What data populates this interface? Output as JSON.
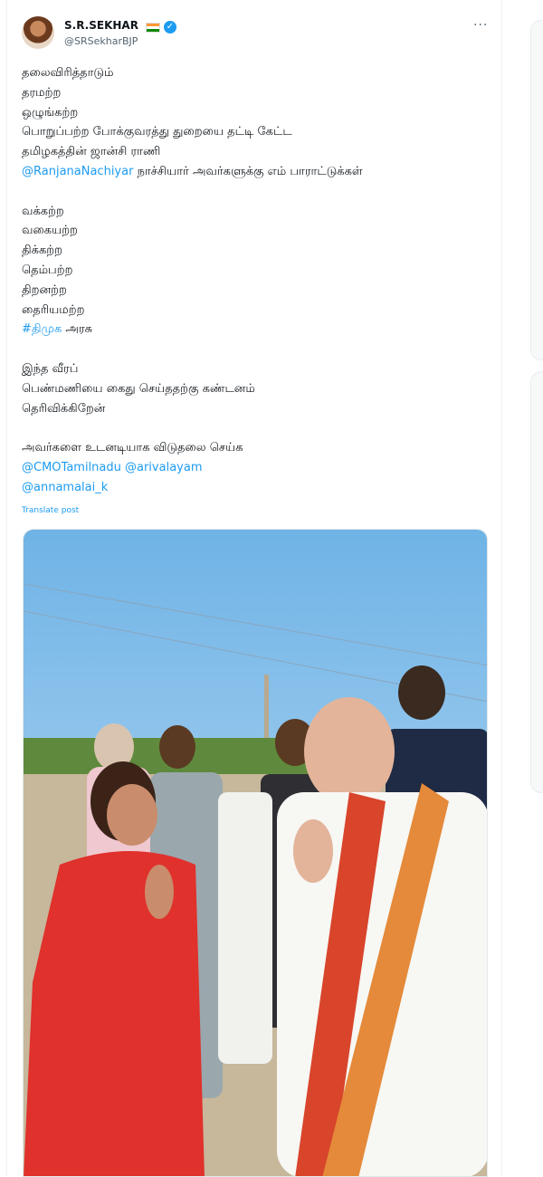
{
  "post": {
    "author_name": "S.R.SEKHAR",
    "author_handle": "@SRSekharBJP",
    "more_label": "···",
    "paragraphs": [
      [
        {
          "text": "தலைவிரித்தாடும்",
          "link": false
        },
        {
          "text": "தரமற்ற",
          "link": false
        },
        {
          "text": "ஒழுங்கற்ற",
          "link": false
        },
        {
          "text": "பொறுப்பற்ற போக்குவரத்து துறையை தட்டி கேட்ட",
          "link": false
        },
        {
          "text": "தமிழகத்தின் ஜான்சி ராணி",
          "link": false
        },
        {
          "text": "@RanjanaNachiyar",
          "link": true,
          "rest": " நாச்சியார் அவர்களுக்கு எம் பாராட்டுக்கள்"
        }
      ],
      [
        {
          "text": "வக்கற்ற",
          "link": false
        },
        {
          "text": "வகையற்ற",
          "link": false
        },
        {
          "text": "திக்கற்ற",
          "link": false
        },
        {
          "text": "தெம்பற்ற",
          "link": false
        },
        {
          "text": "திறனற்ற",
          "link": false
        },
        {
          "text": "தைரியமற்ற",
          "link": false
        },
        {
          "text": "#திமுக",
          "link": true,
          "rest": " அரசு"
        }
      ],
      [
        {
          "text": "இந்த வீரப்",
          "link": false
        },
        {
          "text": "பெண்மணியை கைது செய்ததற்கு கண்டனம்",
          "link": false
        },
        {
          "text": "தெரிவிக்கிறேன்",
          "link": false
        }
      ],
      [
        {
          "text": "அவர்களை உடனடியாக விடுதலை செய்க",
          "link": false
        },
        {
          "text": "@CMOTamilnadu @arivalayam",
          "link": true,
          "rest": ""
        },
        {
          "text": "@annamalai_k",
          "link": true,
          "rest": ""
        }
      ]
    ],
    "translate_label": "Translate post"
  },
  "icons": {
    "verified": "verified-badge-icon",
    "flag": "india-flag-icon",
    "more": "more-options-icon"
  },
  "colors": {
    "link": "#1d9bf0",
    "secondary_text": "#536471"
  }
}
